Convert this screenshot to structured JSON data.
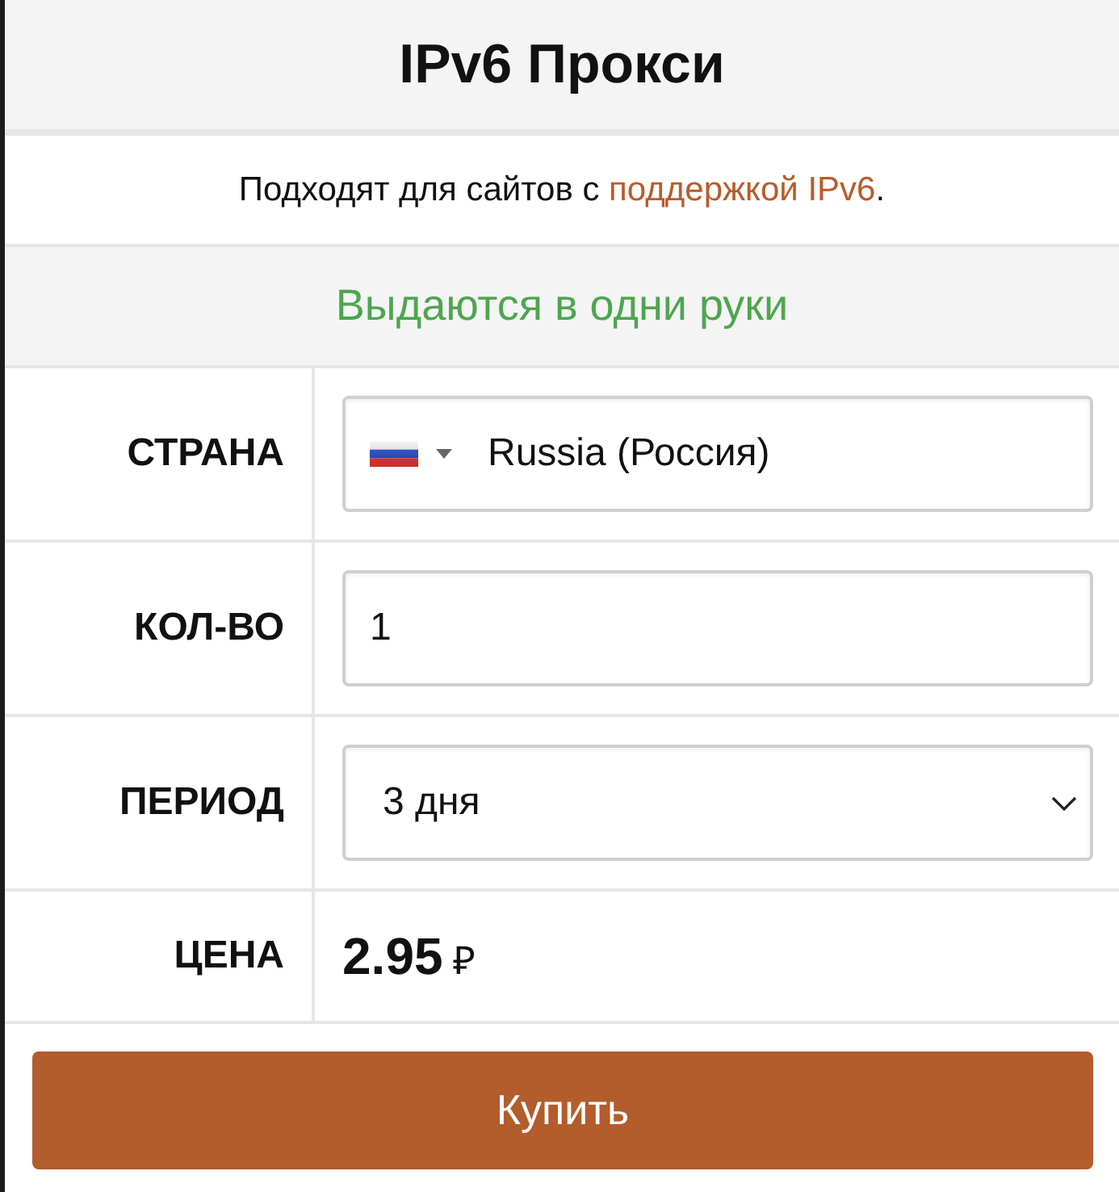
{
  "header": {
    "title": "IPv6 Прокси"
  },
  "subtitle": {
    "before": "Подходят для сайтов с",
    "link": "поддержкой IPv6",
    "after": "."
  },
  "notice": {
    "text": "Выдаются в одни руки"
  },
  "form": {
    "rows": [
      {
        "kind": "country",
        "label": "СТРАНА",
        "value": "Russia (Россия)"
      },
      {
        "kind": "quantity",
        "label": "КОЛ-ВО",
        "value": "1"
      },
      {
        "kind": "period",
        "label": "ПЕРИОД",
        "value": "3 дня"
      },
      {
        "kind": "price",
        "label": "ЦЕНА",
        "amount": "2.95",
        "currency": "₽"
      }
    ]
  },
  "buy_button": {
    "label": "Купить"
  }
}
